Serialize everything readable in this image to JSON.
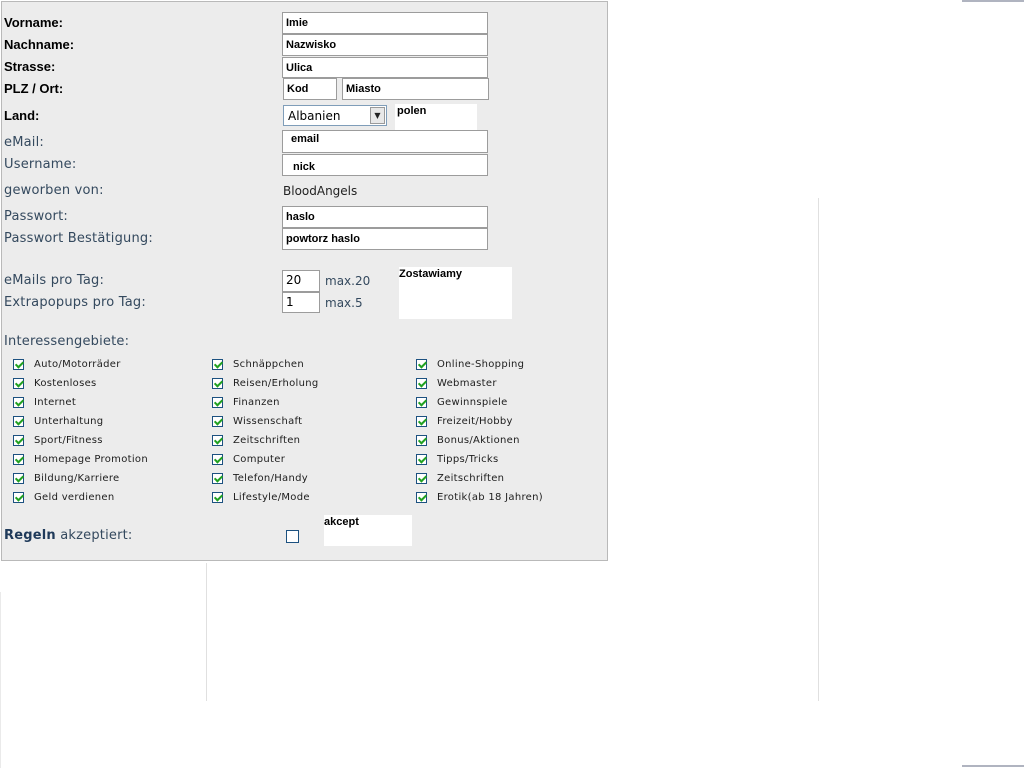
{
  "form": {
    "vorname": {
      "label": "Vorname:",
      "value": "Imie"
    },
    "nachname": {
      "label": "Nachname:",
      "value": "Nazwisko"
    },
    "strasse": {
      "label": "Strasse:",
      "value": "Ulica"
    },
    "plz_ort": {
      "label": "PLZ / Ort:",
      "plz_value": "Kod",
      "ort_value": "Miasto"
    },
    "land": {
      "label": "Land:",
      "selected": "Albanien",
      "note": "polen"
    },
    "email": {
      "label": "eMail:",
      "value": "email"
    },
    "username": {
      "label": "Username:",
      "value": "nick"
    },
    "geworben": {
      "label": "geworben von:",
      "value": "BloodAngels"
    },
    "passwort": {
      "label": "Passwort:",
      "value": "haslo"
    },
    "passwort_bestaetigung": {
      "label": "Passwort Bestätigung:",
      "value": "powtorz haslo"
    },
    "emails_pro_tag": {
      "label": "eMails pro Tag:",
      "value": "20",
      "max": "max.20"
    },
    "extrapopups": {
      "label": "Extrapopups pro Tag:",
      "value": "1",
      "max": "max.5"
    },
    "zostawiamy_note": "Zostawiamy",
    "interessen": {
      "label": "Interessengebiete:",
      "columns": [
        [
          "Auto/Motorräder",
          "Kostenloses",
          "Internet",
          "Unterhaltung",
          "Sport/Fitness",
          "Homepage Promotion",
          "Bildung/Karriere",
          "Geld verdienen"
        ],
        [
          "Schnäppchen",
          "Reisen/Erholung",
          "Finanzen",
          "Wissenschaft",
          "Zeitschriften",
          "Computer",
          "Telefon/Handy",
          "Lifestyle/Mode"
        ],
        [
          "Online-Shopping",
          "Webmaster",
          "Gewinnspiele",
          "Freizeit/Hobby",
          "Bonus/Aktionen",
          "Tipps/Tricks",
          "Zeitschriften",
          "Erotik(ab 18 Jahren)"
        ]
      ],
      "all_checked": true
    },
    "regeln": {
      "label_bold": "Regeln",
      "label_rest": "akzeptiert:",
      "checked": false,
      "note": "akcept"
    }
  }
}
